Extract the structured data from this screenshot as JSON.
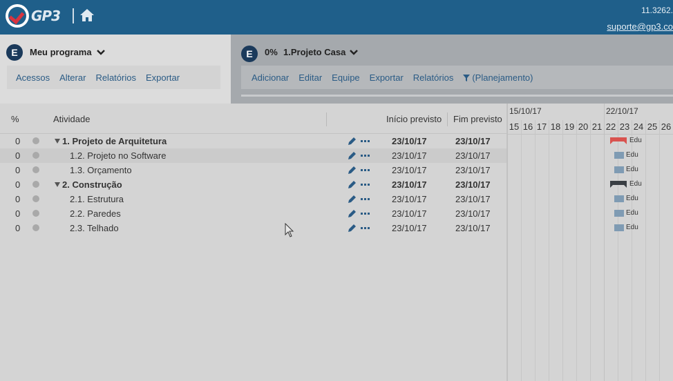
{
  "topbar": {
    "logo_text": "GP3",
    "right_text": "11.3262.",
    "email": "suporte@gp3.co"
  },
  "left_panel": {
    "badge": "E",
    "title": "Meu programa",
    "menu": [
      "Acessos",
      "Alterar",
      "Relatórios",
      "Exportar"
    ]
  },
  "right_panel": {
    "badge": "E",
    "progress": "0%",
    "title": "1.Projeto Casa",
    "menu": [
      "Adicionar",
      "Editar",
      "Equipe",
      "Exportar",
      "Relatórios"
    ],
    "filter_label": "(Planejamento)"
  },
  "grid": {
    "headers": {
      "percent": "%",
      "activity": "Atividade",
      "start": "Início previsto",
      "end": "Fim previsto"
    },
    "rows": [
      {
        "pct": "0",
        "name": "1. Projeto de Arquitetura",
        "start": "23/10/17",
        "end": "23/10/17",
        "summary": true
      },
      {
        "pct": "0",
        "name": "1.2. Projeto no Software",
        "start": "23/10/17",
        "end": "23/10/17",
        "summary": false
      },
      {
        "pct": "0",
        "name": "1.3. Orçamento",
        "start": "23/10/17",
        "end": "23/10/17",
        "summary": false
      },
      {
        "pct": "0",
        "name": "2. Construção",
        "start": "23/10/17",
        "end": "23/10/17",
        "summary": true
      },
      {
        "pct": "0",
        "name": "2.1. Estrutura",
        "start": "23/10/17",
        "end": "23/10/17",
        "summary": false
      },
      {
        "pct": "0",
        "name": "2.2. Paredes",
        "start": "23/10/17",
        "end": "23/10/17",
        "summary": false
      },
      {
        "pct": "0",
        "name": "2.3. Telhado",
        "start": "23/10/17",
        "end": "23/10/17",
        "summary": false
      }
    ]
  },
  "gantt": {
    "weeks": [
      "15/10/17",
      "22/10/17"
    ],
    "days": [
      "15",
      "16",
      "17",
      "18",
      "19",
      "20",
      "21",
      "22",
      "23",
      "24",
      "25",
      "26"
    ],
    "resource": "Edu",
    "summary_colors": [
      "#d9534f",
      "#3a3f44"
    ],
    "task_color": "#7f9bb3"
  },
  "colors": {
    "topbar": "#1f5f8a",
    "link": "#2a5b85"
  }
}
